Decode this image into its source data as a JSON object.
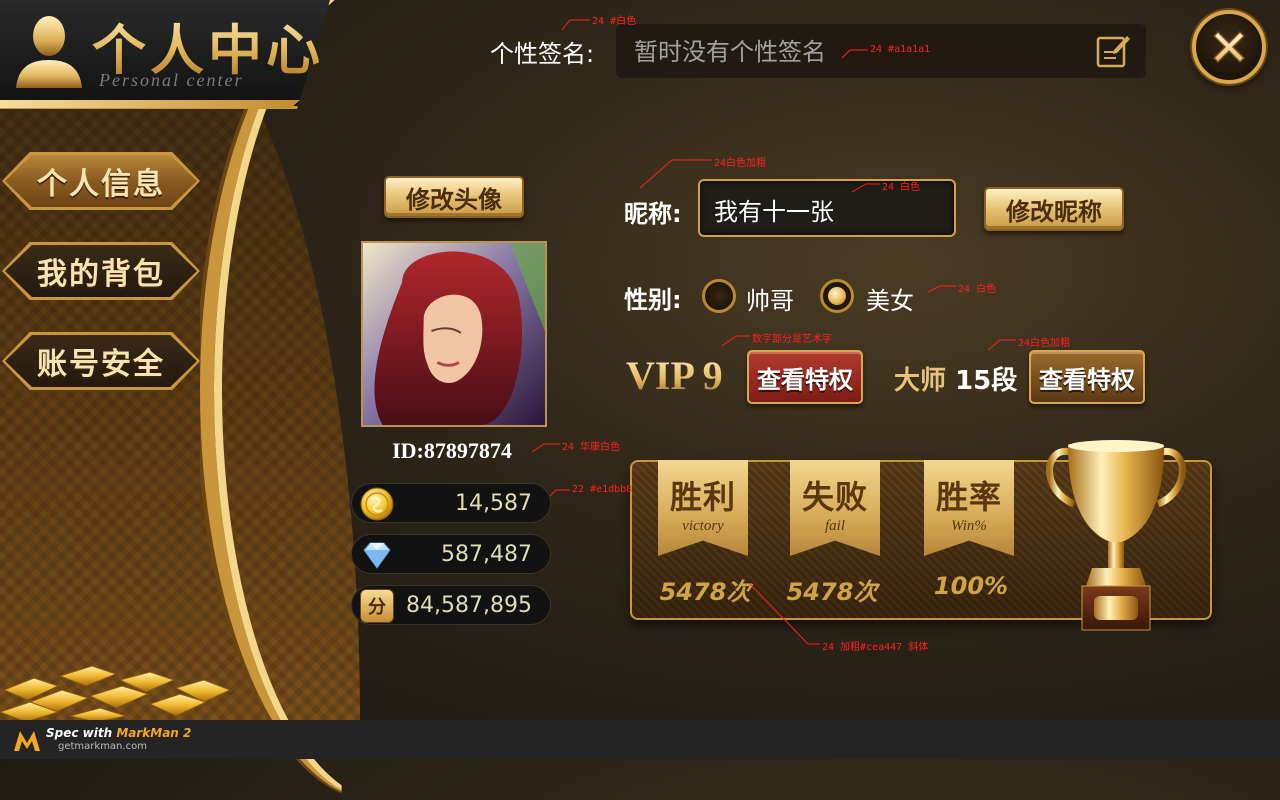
{
  "header": {
    "title": "个人中心",
    "subtitle": "Personal center"
  },
  "nav": {
    "items": [
      {
        "label": "个人信息",
        "active": true
      },
      {
        "label": "我的背包",
        "active": false
      },
      {
        "label": "账号安全",
        "active": false
      }
    ]
  },
  "signature": {
    "label": "个性签名:",
    "placeholder": "暂时没有个性签名"
  },
  "profile": {
    "change_avatar_label": "修改头像",
    "user_id": "ID:87897874",
    "currencies": {
      "coins": "14,587",
      "diamonds": "587,487",
      "points": "84,587,895",
      "points_icon_glyph": "分"
    }
  },
  "nickname": {
    "label": "昵称:",
    "value": "我有十一张",
    "change_label": "修改昵称"
  },
  "gender": {
    "label": "性别:",
    "options": [
      {
        "label": "帅哥",
        "selected": false
      },
      {
        "label": "美女",
        "selected": true
      }
    ]
  },
  "vip": {
    "text": "VIP 9",
    "privilege_label": "查看特权"
  },
  "rank": {
    "title_prefix": "大师",
    "title_number": "15段",
    "privilege_label": "查看特权"
  },
  "stats": [
    {
      "cn": "胜利",
      "en": "victory",
      "value": "5478次"
    },
    {
      "cn": "失败",
      "en": "fail",
      "value": "5478次"
    },
    {
      "cn": "胜率",
      "en": "Win%",
      "value": "100%"
    }
  ],
  "annotations": {
    "signature_label_note": "24 #白色",
    "signature_placeholder_note": "24 #a1a1a1",
    "nickname_label_note": "24白色加粗",
    "nickname_value_note": "24 白色",
    "gender_note": "24 白色",
    "vip_note": "数字部分是艺术字",
    "rank_note": "24白色加粗",
    "id_note": "24 华康白色",
    "currency_note": "22 #e1dbb8",
    "stats_note": "24 加粗#cea447 斜体"
  },
  "markman": {
    "spec_prefix": "Spec with",
    "spec_product": "MarkMan 2",
    "site": "getmarkman.com"
  },
  "colors": {
    "gold": "#c9963c",
    "signature_placeholder": "#a1a1a1",
    "currency_text": "#e1dbb8",
    "stat_text": "#cea447",
    "annotation": "#ff2020"
  },
  "icons": [
    "person-silhouette-icon",
    "edit-icon",
    "close-icon",
    "gold-coin-icon",
    "diamond-icon",
    "points-icon",
    "trophy-icon",
    "gold-bars-icon",
    "markman-logo-icon"
  ]
}
